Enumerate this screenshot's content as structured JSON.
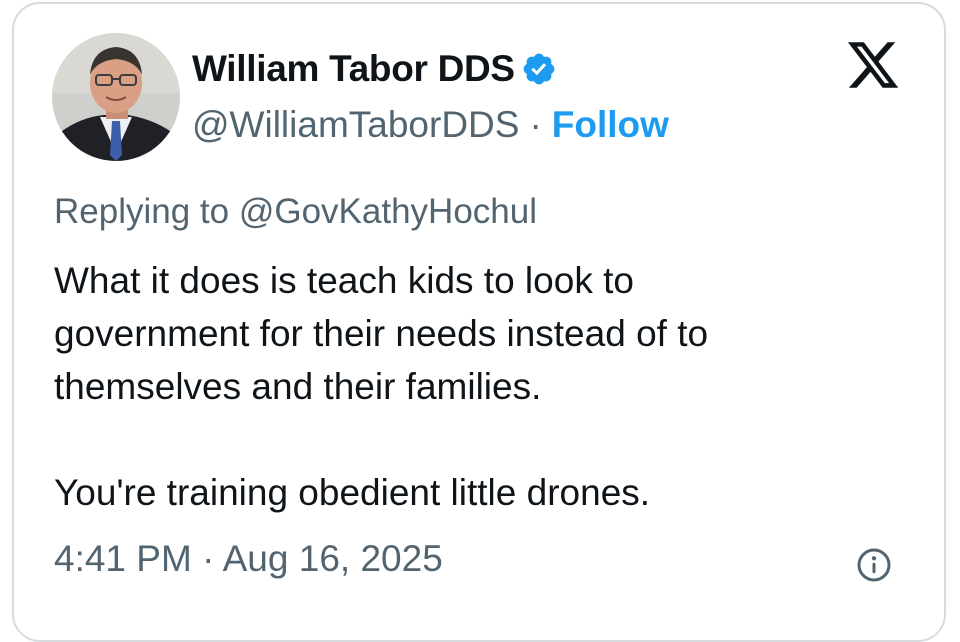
{
  "author": {
    "display_name": "William Tabor DDS",
    "handle": "@WilliamTaborDDS",
    "separator": "·",
    "follow_label": "Follow",
    "verified_icon": "verified-badge-icon",
    "avatar_icon": "profile-photo"
  },
  "reply": {
    "prefix": "Replying to ",
    "mention": "@GovKathyHochul"
  },
  "tweet": {
    "lines": [
      "What it does is teach kids to look to",
      "government for their needs instead of to",
      "themselves and their families.",
      "You're training obedient little drones."
    ]
  },
  "meta": {
    "timestamp": "4:41 PM · Aug 16, 2025",
    "info_icon": "info-icon"
  },
  "colors": {
    "accent": "#1d9bf0",
    "text": "#0f1419",
    "muted": "#536471",
    "border": "#d6dbe0"
  },
  "brand_icon": "x-logo-icon"
}
